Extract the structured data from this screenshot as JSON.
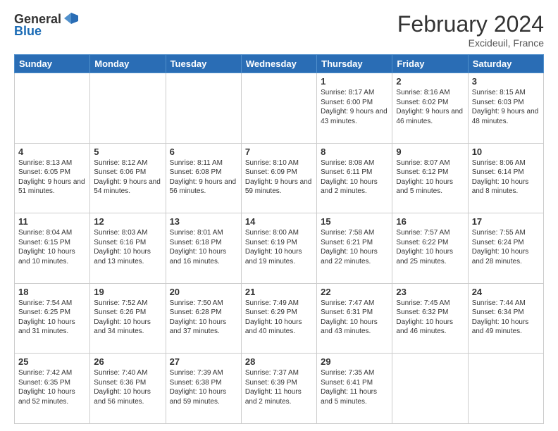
{
  "header": {
    "logo_general": "General",
    "logo_blue": "Blue",
    "month_title": "February 2024",
    "location": "Excideuil, France"
  },
  "days_of_week": [
    "Sunday",
    "Monday",
    "Tuesday",
    "Wednesday",
    "Thursday",
    "Friday",
    "Saturday"
  ],
  "weeks": [
    [
      {
        "day": "",
        "info": ""
      },
      {
        "day": "",
        "info": ""
      },
      {
        "day": "",
        "info": ""
      },
      {
        "day": "",
        "info": ""
      },
      {
        "day": "1",
        "info": "Sunrise: 8:17 AM\nSunset: 6:00 PM\nDaylight: 9 hours and 43 minutes."
      },
      {
        "day": "2",
        "info": "Sunrise: 8:16 AM\nSunset: 6:02 PM\nDaylight: 9 hours and 46 minutes."
      },
      {
        "day": "3",
        "info": "Sunrise: 8:15 AM\nSunset: 6:03 PM\nDaylight: 9 hours and 48 minutes."
      }
    ],
    [
      {
        "day": "4",
        "info": "Sunrise: 8:13 AM\nSunset: 6:05 PM\nDaylight: 9 hours and 51 minutes."
      },
      {
        "day": "5",
        "info": "Sunrise: 8:12 AM\nSunset: 6:06 PM\nDaylight: 9 hours and 54 minutes."
      },
      {
        "day": "6",
        "info": "Sunrise: 8:11 AM\nSunset: 6:08 PM\nDaylight: 9 hours and 56 minutes."
      },
      {
        "day": "7",
        "info": "Sunrise: 8:10 AM\nSunset: 6:09 PM\nDaylight: 9 hours and 59 minutes."
      },
      {
        "day": "8",
        "info": "Sunrise: 8:08 AM\nSunset: 6:11 PM\nDaylight: 10 hours and 2 minutes."
      },
      {
        "day": "9",
        "info": "Sunrise: 8:07 AM\nSunset: 6:12 PM\nDaylight: 10 hours and 5 minutes."
      },
      {
        "day": "10",
        "info": "Sunrise: 8:06 AM\nSunset: 6:14 PM\nDaylight: 10 hours and 8 minutes."
      }
    ],
    [
      {
        "day": "11",
        "info": "Sunrise: 8:04 AM\nSunset: 6:15 PM\nDaylight: 10 hours and 10 minutes."
      },
      {
        "day": "12",
        "info": "Sunrise: 8:03 AM\nSunset: 6:16 PM\nDaylight: 10 hours and 13 minutes."
      },
      {
        "day": "13",
        "info": "Sunrise: 8:01 AM\nSunset: 6:18 PM\nDaylight: 10 hours and 16 minutes."
      },
      {
        "day": "14",
        "info": "Sunrise: 8:00 AM\nSunset: 6:19 PM\nDaylight: 10 hours and 19 minutes."
      },
      {
        "day": "15",
        "info": "Sunrise: 7:58 AM\nSunset: 6:21 PM\nDaylight: 10 hours and 22 minutes."
      },
      {
        "day": "16",
        "info": "Sunrise: 7:57 AM\nSunset: 6:22 PM\nDaylight: 10 hours and 25 minutes."
      },
      {
        "day": "17",
        "info": "Sunrise: 7:55 AM\nSunset: 6:24 PM\nDaylight: 10 hours and 28 minutes."
      }
    ],
    [
      {
        "day": "18",
        "info": "Sunrise: 7:54 AM\nSunset: 6:25 PM\nDaylight: 10 hours and 31 minutes."
      },
      {
        "day": "19",
        "info": "Sunrise: 7:52 AM\nSunset: 6:26 PM\nDaylight: 10 hours and 34 minutes."
      },
      {
        "day": "20",
        "info": "Sunrise: 7:50 AM\nSunset: 6:28 PM\nDaylight: 10 hours and 37 minutes."
      },
      {
        "day": "21",
        "info": "Sunrise: 7:49 AM\nSunset: 6:29 PM\nDaylight: 10 hours and 40 minutes."
      },
      {
        "day": "22",
        "info": "Sunrise: 7:47 AM\nSunset: 6:31 PM\nDaylight: 10 hours and 43 minutes."
      },
      {
        "day": "23",
        "info": "Sunrise: 7:45 AM\nSunset: 6:32 PM\nDaylight: 10 hours and 46 minutes."
      },
      {
        "day": "24",
        "info": "Sunrise: 7:44 AM\nSunset: 6:34 PM\nDaylight: 10 hours and 49 minutes."
      }
    ],
    [
      {
        "day": "25",
        "info": "Sunrise: 7:42 AM\nSunset: 6:35 PM\nDaylight: 10 hours and 52 minutes."
      },
      {
        "day": "26",
        "info": "Sunrise: 7:40 AM\nSunset: 6:36 PM\nDaylight: 10 hours and 56 minutes."
      },
      {
        "day": "27",
        "info": "Sunrise: 7:39 AM\nSunset: 6:38 PM\nDaylight: 10 hours and 59 minutes."
      },
      {
        "day": "28",
        "info": "Sunrise: 7:37 AM\nSunset: 6:39 PM\nDaylight: 11 hours and 2 minutes."
      },
      {
        "day": "29",
        "info": "Sunrise: 7:35 AM\nSunset: 6:41 PM\nDaylight: 11 hours and 5 minutes."
      },
      {
        "day": "",
        "info": ""
      },
      {
        "day": "",
        "info": ""
      }
    ]
  ]
}
